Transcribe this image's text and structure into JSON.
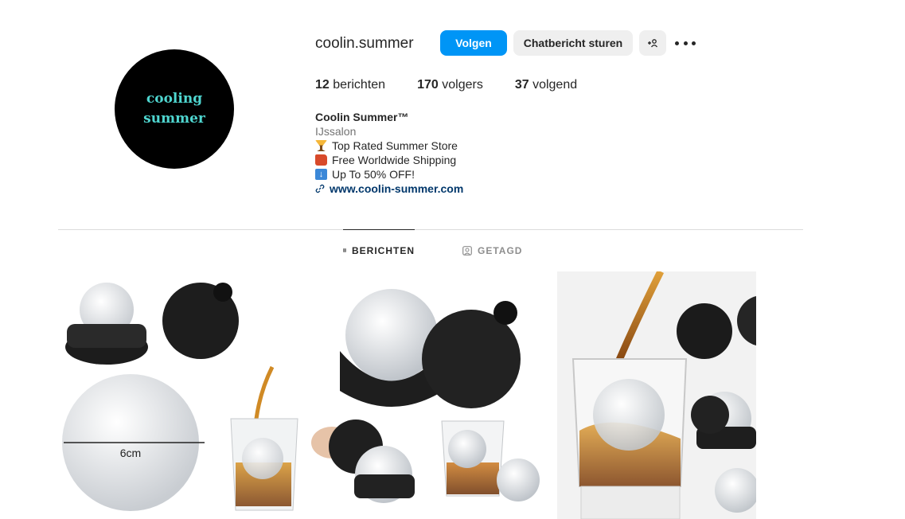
{
  "profile": {
    "avatar_line1": "cooling",
    "avatar_line2": "summer",
    "username": "coolin.summer",
    "follow_label": "Volgen",
    "message_label": "Chatbericht sturen",
    "add_label": "+8",
    "stats": {
      "posts_count": "12",
      "posts_label": "berichten",
      "followers_count": "170",
      "followers_label": "volgers",
      "following_count": "37",
      "following_label": "volgend"
    },
    "bio": {
      "name": "Coolin Summer™",
      "category": "IJssalon",
      "line1": "Top Rated Summer Store",
      "line2": "Free Worldwide Shipping",
      "line3": "Up To 50% OFF!",
      "link": "www.coolin-summer.com"
    }
  },
  "tabs": {
    "posts": "BERICHTEN",
    "tagged": "GETAGD"
  },
  "posts": [
    {
      "label": "6cm"
    },
    {
      "label": ""
    },
    {
      "label": ""
    }
  ],
  "colors": {
    "accent": "#0095f6",
    "link": "#00376b",
    "avatar_text": "#4fd6d0"
  }
}
